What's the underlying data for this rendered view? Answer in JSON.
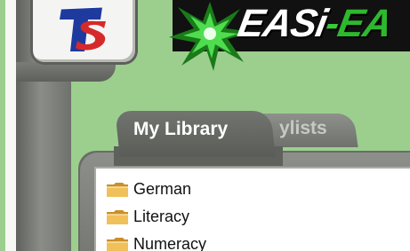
{
  "logo": {
    "text": "TS",
    "icon": "ts-logo-icon"
  },
  "banner": {
    "text_main": "EASi",
    "text_dash": "-",
    "text_tail": "EA",
    "icon": "starburst-icon"
  },
  "tabs": [
    {
      "label": "My Library",
      "active": true
    },
    {
      "label": "ylists",
      "active": false
    }
  ],
  "folders": [
    {
      "label": "German",
      "icon": "folder-icon"
    },
    {
      "label": "Literacy",
      "icon": "folder-icon"
    },
    {
      "label": "Numeracy",
      "icon": "folder-icon"
    }
  ],
  "colors": {
    "background": "#9ccf8e",
    "frame": "#6f716c",
    "banner": "#111111",
    "accent_green": "#2eb82e",
    "folder": "#e9b54a"
  }
}
